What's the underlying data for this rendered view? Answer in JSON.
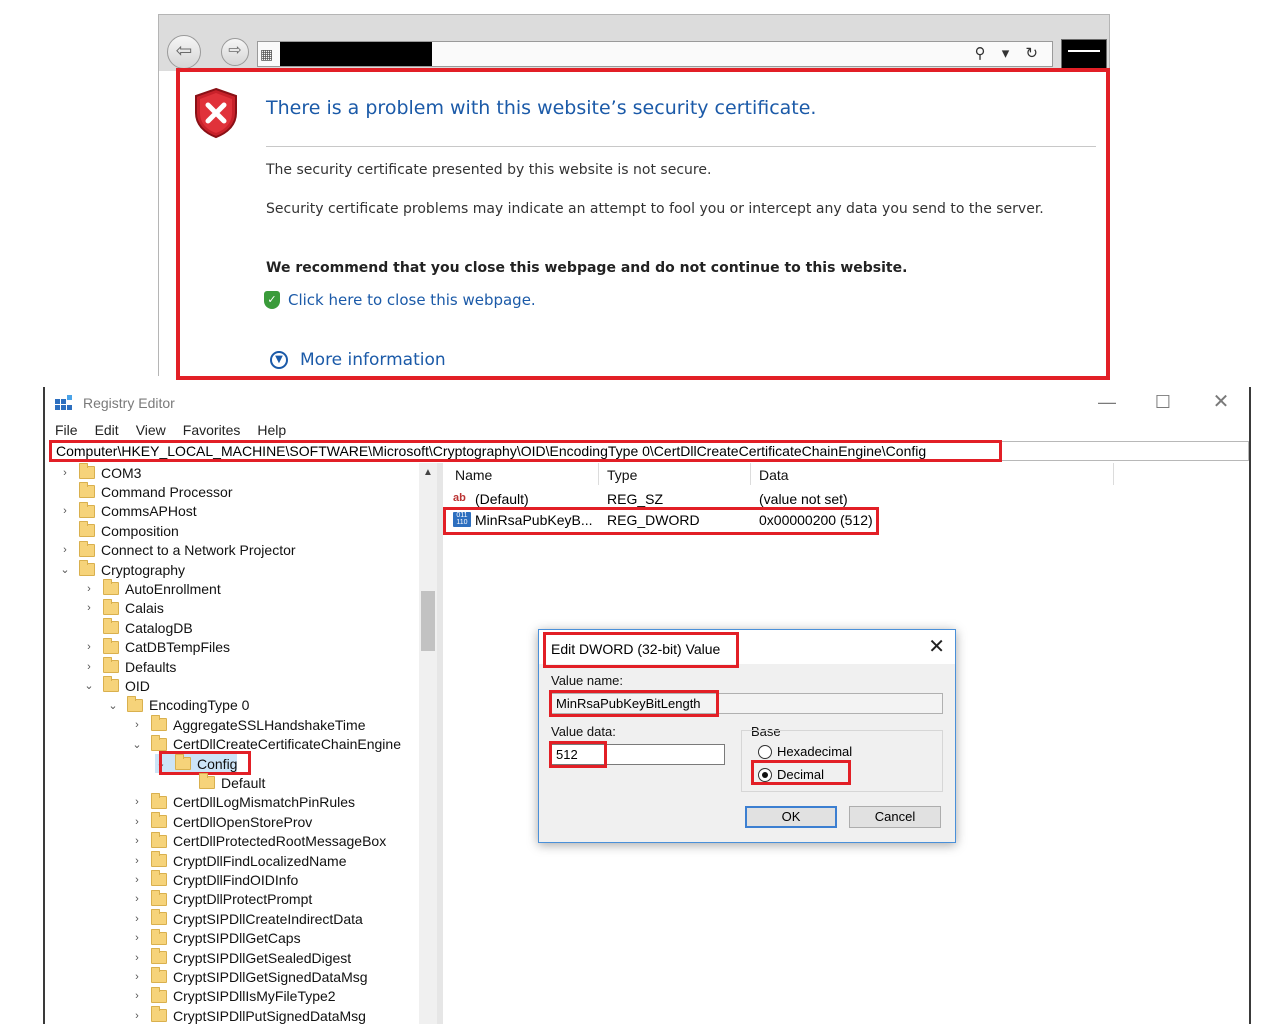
{
  "browser": {
    "back_icon": "back-arrow-icon",
    "forward_icon": "forward-arrow-icon",
    "address_tools": "⚲ ▾ ↻",
    "error_page": {
      "title": "There is a problem with this website’s security certificate.",
      "p1": "The security certificate presented by this website is not secure.",
      "p2": "Security certificate problems may indicate an attempt to fool you or intercept any data you send to the server.",
      "p3": "We recommend that you close this webpage and do not continue to this website.",
      "close_link": "Click here to close this webpage.",
      "more_info": "More information"
    }
  },
  "registry": {
    "title": "Registry Editor",
    "window_controls": {
      "minimize": "—",
      "maximize": "☐",
      "close": "✕"
    },
    "menu": [
      "File",
      "Edit",
      "View",
      "Favorites",
      "Help"
    ],
    "address": "Computer\\HKEY_LOCAL_MACHINE\\SOFTWARE\\Microsoft\\Cryptography\\OID\\EncodingType 0\\CertDllCreateCertificateChainEngine\\Config",
    "tree": [
      {
        "label": "COM3",
        "level": 0,
        "expander": ">"
      },
      {
        "label": "Command Processor",
        "level": 0,
        "expander": ""
      },
      {
        "label": "CommsAPHost",
        "level": 0,
        "expander": ">"
      },
      {
        "label": "Composition",
        "level": 0,
        "expander": ""
      },
      {
        "label": "Connect to a Network Projector",
        "level": 0,
        "expander": ">"
      },
      {
        "label": "Cryptography",
        "level": 0,
        "expander": "v"
      },
      {
        "label": "AutoEnrollment",
        "level": 1,
        "expander": ">"
      },
      {
        "label": "Calais",
        "level": 1,
        "expander": ">"
      },
      {
        "label": "CatalogDB",
        "level": 1,
        "expander": ""
      },
      {
        "label": "CatDBTempFiles",
        "level": 1,
        "expander": ">"
      },
      {
        "label": "Defaults",
        "level": 1,
        "expander": ">"
      },
      {
        "label": "OID",
        "level": 1,
        "expander": "v"
      },
      {
        "label": "EncodingType 0",
        "level": 2,
        "expander": "v"
      },
      {
        "label": "AggregateSSLHandshakeTime",
        "level": 3,
        "expander": ">"
      },
      {
        "label": "CertDllCreateCertificateChainEngine",
        "level": 3,
        "expander": "v"
      },
      {
        "label": "Config",
        "level": 4,
        "expander": "v"
      },
      {
        "label": "Default",
        "level": 5,
        "expander": ""
      },
      {
        "label": "CertDllLogMismatchPinRules",
        "level": 3,
        "expander": ">"
      },
      {
        "label": "CertDllOpenStoreProv",
        "level": 3,
        "expander": ">"
      },
      {
        "label": "CertDllProtectedRootMessageBox",
        "level": 3,
        "expander": ">"
      },
      {
        "label": "CryptDllFindLocalizedName",
        "level": 3,
        "expander": ">"
      },
      {
        "label": "CryptDllFindOIDInfo",
        "level": 3,
        "expander": ">"
      },
      {
        "label": "CryptDllProtectPrompt",
        "level": 3,
        "expander": ">"
      },
      {
        "label": "CryptSIPDllCreateIndirectData",
        "level": 3,
        "expander": ">"
      },
      {
        "label": "CryptSIPDllGetCaps",
        "level": 3,
        "expander": ">"
      },
      {
        "label": "CryptSIPDllGetSealedDigest",
        "level": 3,
        "expander": ">"
      },
      {
        "label": "CryptSIPDllGetSignedDataMsg",
        "level": 3,
        "expander": ">"
      },
      {
        "label": "CryptSIPDllIsMyFileType2",
        "level": 3,
        "expander": ">"
      },
      {
        "label": "CryptSIPDllPutSignedDataMsg",
        "level": 3,
        "expander": ">"
      }
    ],
    "columns": [
      "Name",
      "Type",
      "Data"
    ],
    "values": [
      {
        "icon": "string-value-icon",
        "name": "(Default)",
        "type": "REG_SZ",
        "data": "(value not set)"
      },
      {
        "icon": "dword-value-icon",
        "name": "MinRsaPubKeyB...",
        "type": "REG_DWORD",
        "data": "0x00000200 (512)"
      }
    ]
  },
  "dialog": {
    "title": "Edit DWORD (32-bit) Value",
    "close": "✕",
    "value_name_label": "Value name:",
    "value_name": "MinRsaPubKeyBitLength",
    "value_data_label": "Value data:",
    "value_data": "512",
    "base_label": "Base",
    "hex_label": "Hexadecimal",
    "dec_label": "Decimal",
    "selected_base": "Decimal",
    "ok": "OK",
    "cancel": "Cancel"
  },
  "colors": {
    "highlight_red": "#e21f26",
    "link_blue": "#1b5aa8",
    "folder_yellow": "#f6d37a"
  }
}
